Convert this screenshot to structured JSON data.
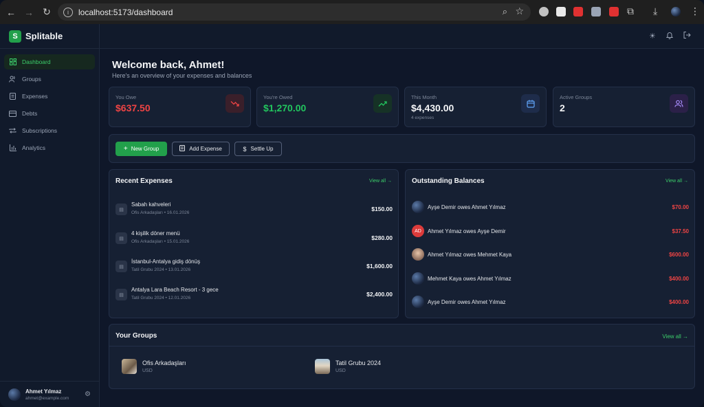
{
  "browser": {
    "url": "localhost:5173/dashboard"
  },
  "app": {
    "brand_letter": "S",
    "brand_name": "Splitable"
  },
  "sidebar": {
    "items": [
      {
        "label": "Dashboard",
        "icon": "dashboard-icon",
        "active": true
      },
      {
        "label": "Groups",
        "icon": "users-icon",
        "active": false
      },
      {
        "label": "Expenses",
        "icon": "receipt-icon",
        "active": false
      },
      {
        "label": "Debts",
        "icon": "credit-card-icon",
        "active": false
      },
      {
        "label": "Subscriptions",
        "icon": "repeat-icon",
        "active": false
      },
      {
        "label": "Analytics",
        "icon": "bar-chart-icon",
        "active": false
      }
    ],
    "user": {
      "name": "Ahmet Yılmaz",
      "email": "ahmet@example.com"
    }
  },
  "header": {
    "welcome": "Welcome back, Ahmet!",
    "subtitle": "Here's an overview of your expenses and balances"
  },
  "stats": [
    {
      "label": "You Owe",
      "value": "$637.50",
      "extra": "",
      "color": "#ef4444",
      "icon": "trending-down-icon"
    },
    {
      "label": "You're Owed",
      "value": "$1,270.00",
      "extra": "",
      "color": "#22c55e",
      "icon": "trending-up-icon"
    },
    {
      "label": "This Month",
      "value": "$4,430.00",
      "extra": "4 expenses",
      "color": "#f3f4f6",
      "icon": "calendar-icon"
    },
    {
      "label": "Active Groups",
      "value": "2",
      "extra": "",
      "color": "#f3f4f6",
      "icon": "users-icon"
    }
  ],
  "actions": {
    "new_group": "New Group",
    "add_expense": "Add Expense",
    "settle_up": "Settle Up"
  },
  "recent_expenses": {
    "title": "Recent Expenses",
    "view_all": "View all",
    "items": [
      {
        "title": "Sabah kahveleri",
        "group": "Ofis Arkadaşları",
        "date": "16.01.2026",
        "amount": "$150.00"
      },
      {
        "title": "4 kişilik döner menü",
        "group": "Ofis Arkadaşları",
        "date": "15.01.2026",
        "amount": "$280.00"
      },
      {
        "title": "İstanbul-Antalya gidiş dönüş",
        "group": "Tatil Grubu 2024",
        "date": "13.01.2026",
        "amount": "$1,600.00"
      },
      {
        "title": "Antalya Lara Beach Resort - 3 gece",
        "group": "Tatil Grubu 2024",
        "date": "12.01.2026",
        "amount": "$2,400.00"
      }
    ]
  },
  "outstanding_balances": {
    "title": "Outstanding Balances",
    "view_all": "View all",
    "items": [
      {
        "text": "Ayşe Demir owes Ahmet Yılmaz",
        "amount": "$70.00",
        "avatar": ""
      },
      {
        "text": "Ahmet Yılmaz owes Ayşe Demir",
        "amount": "$37.50",
        "avatar": "AD"
      },
      {
        "text": "Ahmet Yılmaz owes Mehmet Kaya",
        "amount": "$600.00",
        "avatar": ""
      },
      {
        "text": "Mehmet Kaya owes Ahmet Yılmaz",
        "amount": "$400.00",
        "avatar": ""
      },
      {
        "text": "Ayşe Demir owes Ahmet Yılmaz",
        "amount": "$400.00",
        "avatar": ""
      }
    ]
  },
  "groups": {
    "title": "Your Groups",
    "view_all": "View all",
    "items": [
      {
        "name": "Ofis Arkadaşları",
        "currency": "USD"
      },
      {
        "name": "Tatil Grubu 2024",
        "currency": "USD"
      }
    ]
  }
}
